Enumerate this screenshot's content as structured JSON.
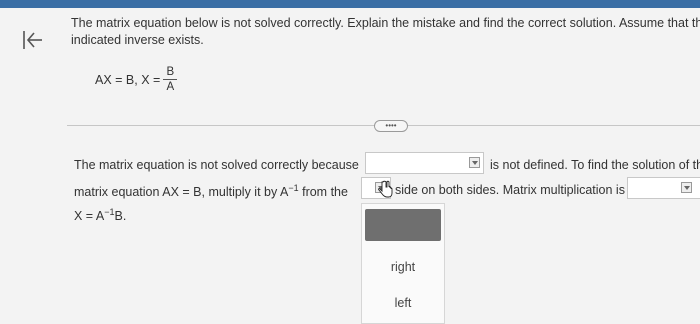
{
  "question": {
    "line1": "The matrix equation below is not solved correctly. Explain the mistake and find the correct solution. Assume that th",
    "line2": "indicated inverse exists.",
    "equation_prefix": "AX = B, X =",
    "frac_num": "B",
    "frac_den": "A"
  },
  "more_button": "••••",
  "answer": {
    "s1": "The matrix equation is not solved correctly because",
    "s2": "is not defined. To find the solution of the",
    "s3a": "matrix equation AX = B, multiply it by A",
    "s3exp": "−1",
    "s3b": "from the",
    "s3c": "side on both sides. Matrix multiplication is",
    "s4a": "X = A",
    "s4exp": "−1",
    "s4b": "B."
  },
  "dropdown_menu": {
    "options": [
      "right",
      "left"
    ]
  },
  "icons": {
    "back": "back-arrow-icon",
    "caret": "chevron-down-icon",
    "cursor": "hand-pointer-icon"
  },
  "colors": {
    "topbar": "#3a6ea5",
    "selected_option": "#6f6f6f"
  }
}
